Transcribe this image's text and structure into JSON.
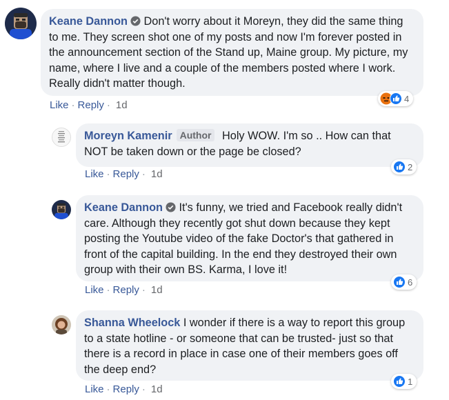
{
  "comments": [
    {
      "author": "Keane Dannon",
      "verified": true,
      "text": "Don't worry about it Moreyn, they did the same thing to me. They screen shot one of my posts and now I'm forever posted in the announcement section of the Stand up, Maine group. My picture, my name, where I live and a couple of the members posted where I work. Really didn't matter though.",
      "reactions": [
        "angry",
        "like"
      ],
      "reaction_count": "4",
      "like_label": "Like",
      "reply_label": "Reply",
      "time": "1d"
    },
    {
      "author": "Moreyn Kamenir",
      "author_tag": "Author",
      "text": "Holy WOW. I'm so .. How can that NOT be taken down or the page be closed?",
      "reactions": [
        "like"
      ],
      "reaction_count": "2",
      "like_label": "Like",
      "reply_label": "Reply",
      "time": "1d"
    },
    {
      "author": "Keane Dannon",
      "verified": true,
      "text": "It's funny, we tried and Facebook really didn't care. Although they recently got shut down because they kept posting the Youtube video of the fake Doctor's that gathered in front of the capital building. In the end they destroyed their own group with their own BS. Karma, I love it!",
      "reactions": [
        "like"
      ],
      "reaction_count": "6",
      "like_label": "Like",
      "reply_label": "Reply",
      "time": "1d"
    },
    {
      "author": "Shanna Wheelock",
      "text": "I wonder if there is a way to report this group to a state hotline - or someone that can be trusted- just so that there is a record in place in case one of their members goes off the deep end?",
      "reactions": [
        "like"
      ],
      "reaction_count": "1",
      "like_label": "Like",
      "reply_label": "Reply",
      "time": "1d"
    }
  ],
  "separator": "·",
  "colors": {
    "author": "#385898",
    "bubble": "#f0f2f5",
    "like": "#1877f2",
    "angry": "#e9710f"
  }
}
